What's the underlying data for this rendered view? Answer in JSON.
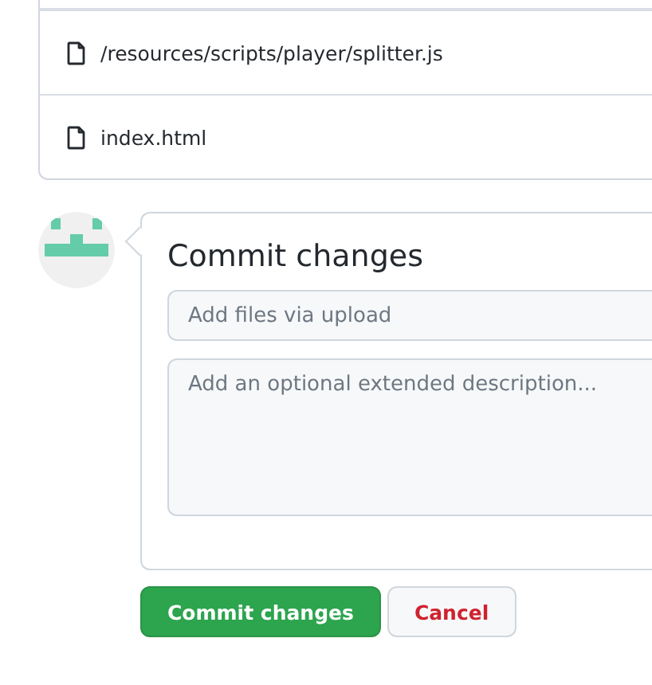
{
  "files": [
    {
      "path": "/resources/scripts/player/splitter.js"
    },
    {
      "path": "index.html"
    }
  ],
  "commit": {
    "title": "Commit changes",
    "summary": {
      "placeholder": "Add files via upload"
    },
    "description": {
      "placeholder": "Add an optional extended description..."
    }
  },
  "buttons": [
    {
      "label": "Commit changes",
      "kind": "primary"
    },
    {
      "label": "Cancel",
      "kind": "cancel"
    }
  ]
}
